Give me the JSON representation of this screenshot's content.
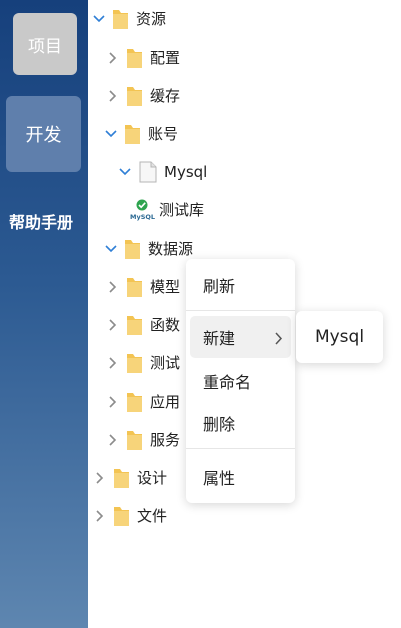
{
  "rail": {
    "project_label": "项目",
    "develop_label": "开发",
    "help_label": "帮助手册"
  },
  "tree": {
    "resources": "资源",
    "config": "配置",
    "cache": "缓存",
    "account": "账号",
    "mysql_doc": "Mysql",
    "mysql_test_db": "测试库",
    "datasource": "数据源",
    "model": "模型",
    "function": "函数",
    "test": "测试",
    "application": "应用",
    "service": "服务",
    "design": "设计",
    "files": "文件",
    "mysql_logo_text": "MySQL"
  },
  "context_menu": {
    "refresh": "刷新",
    "new": "新建",
    "rename": "重命名",
    "delete": "删除",
    "properties": "属性"
  },
  "submenu": {
    "mysql": "Mysql"
  },
  "colors": {
    "rail_top": "#16407c",
    "rail_bottom": "#5e86b0",
    "chevron_expanded": "#2f7fd6",
    "chevron_collapsed": "#8c8c8c",
    "folder": "#f3c453",
    "check_green": "#2ea44f"
  }
}
